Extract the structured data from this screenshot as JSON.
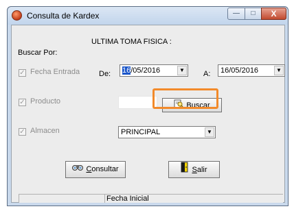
{
  "window": {
    "title": "Consulta de Kardex",
    "controls": {
      "minimize": "—",
      "maximize": "□",
      "close": "X"
    }
  },
  "form": {
    "ultima_toma": "ULTIMA TOMA FISICA :",
    "buscar_por": "Buscar Por:",
    "fecha_entrada": {
      "label": "Fecha Entrada",
      "checked": true
    },
    "de_label": "De:",
    "de_date_selected": "16",
    "de_date_rest": "/05/2016",
    "a_label": "A:",
    "a_date": "16/05/2016",
    "producto": {
      "label": "Producto",
      "checked": true
    },
    "buscar_button_u": "B",
    "buscar_button_rest": "uscar",
    "almacen": {
      "label": "Almacen",
      "checked": true
    },
    "almacen_value": "PRINCIPAL",
    "consultar_button_u": "C",
    "consultar_button_rest": "onsultar",
    "salir_button_u": "S",
    "salir_button_rest": "alir"
  },
  "status": {
    "text": "Fecha Inicial"
  },
  "colors": {
    "highlight": "#f28a2a",
    "selection": "#1a55c9",
    "title_bar": "#c9d9ec"
  },
  "icons": {
    "app": "app-icon",
    "buscar": "search-document-icon",
    "consultar": "binoculars-icon",
    "salir": "exit-door-icon",
    "dropdown": "chevron-down-icon"
  }
}
